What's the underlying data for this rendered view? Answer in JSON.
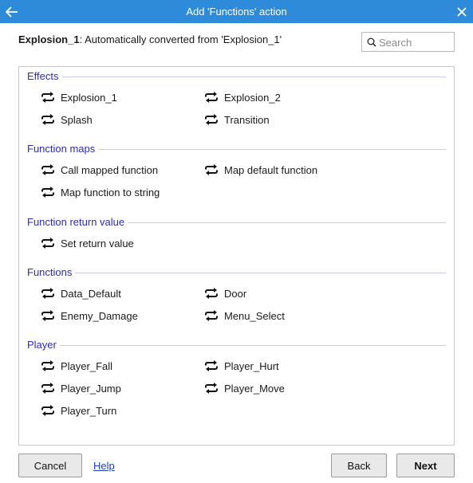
{
  "window": {
    "title": "Add 'Functions' action"
  },
  "header": {
    "object_name": "Explosion_1",
    "description": ": Automatically converted from 'Explosion_1'"
  },
  "search": {
    "placeholder": "Search",
    "value": ""
  },
  "groups": [
    {
      "title": "Effects",
      "items": [
        "Explosion_1",
        "Explosion_2",
        "Splash",
        "Transition"
      ]
    },
    {
      "title": "Function maps",
      "items": [
        "Call mapped function",
        "Map default function",
        "Map function to string"
      ]
    },
    {
      "title": "Function return value",
      "items": [
        "Set return value"
      ]
    },
    {
      "title": "Functions",
      "items": [
        "Data_Default",
        "Door",
        "Enemy_Damage",
        "Menu_Select"
      ]
    },
    {
      "title": "Player",
      "items": [
        "Player_Fall",
        "Player_Hurt",
        "Player_Jump",
        "Player_Move",
        "Player_Turn"
      ]
    }
  ],
  "item_icon": "repeat-arrows-icon",
  "footer": {
    "cancel_label": "Cancel",
    "help_label": "Help",
    "back_label": "Back",
    "next_label": "Next"
  },
  "colors": {
    "titlebar": "#2e8bd9",
    "group_title": "#2b2bb8",
    "link": "#1f3fbf"
  }
}
